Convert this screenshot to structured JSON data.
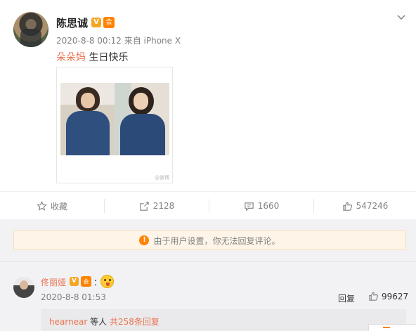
{
  "post": {
    "username": "陈思诚",
    "verified_badge": "V",
    "member_badge": "会",
    "timestamp": "2020-8-8 00:12",
    "source": "来自 iPhone X",
    "mention": "朵朵妈",
    "text": " 生日快乐",
    "image_watermark": "@微博"
  },
  "actions": {
    "favorite": {
      "icon": "star-icon",
      "label": "收藏"
    },
    "repost": {
      "icon": "repost-icon",
      "count": "2128"
    },
    "comment": {
      "icon": "comment-icon",
      "count": "1660"
    },
    "like": {
      "icon": "thumbs-up-icon",
      "count": "547246"
    }
  },
  "notice": {
    "icon": "warning-icon",
    "text": "由于用户设置，你无法回复评论。"
  },
  "comment": {
    "username": "佟丽娅",
    "verified_badge": "V",
    "member_badge": "会",
    "colon": "：",
    "emoji": "tongue-emoji",
    "timestamp": "2020-8-8 01:53",
    "reply_label": "回复",
    "like_count": "99627",
    "sub_reply_user": "hearnear",
    "sub_reply_middle": " 等人 ",
    "sub_reply_link": "共258条回复"
  },
  "colors": {
    "accent_orange": "#eb7350",
    "brand_orange": "#ff8200",
    "notice_bg": "#fef5e8",
    "muted_text": "#808080"
  }
}
